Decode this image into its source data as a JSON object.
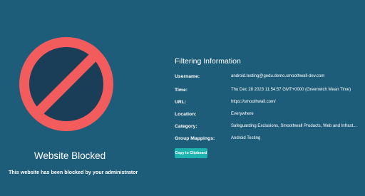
{
  "colors": {
    "background": "#1e5d7a",
    "block_icon_ring": "#f25c5c",
    "block_icon_fill": "#1a3d58",
    "button_background": "#1fb3b0",
    "text": "#ffffff"
  },
  "block_icon": {
    "icon": "prohibited-icon"
  },
  "blocked": {
    "title": "Website Blocked",
    "message": "This website has been blocked by your administrator"
  },
  "filtering": {
    "heading": "Filtering Information",
    "rows": [
      {
        "label": "Username:",
        "value": "android.testing@gedu.demo.smoothwall-dev.com"
      },
      {
        "label": "Time:",
        "value": "Thu Dec 28 2023 11:54:57 GMT+0000 (Greenwich Mean Time)"
      },
      {
        "label": "URL:",
        "value": "https://smoothwall.com/"
      },
      {
        "label": "Location:",
        "value": "Everywhere"
      },
      {
        "label": "Category:",
        "value": "Safeguarding Exclusions, Smoothwall Products, Web and Infrast..."
      },
      {
        "label": "Group Mappings:",
        "value": "Android Testing"
      }
    ],
    "copy_button_label": "Copy to Clipboard"
  }
}
